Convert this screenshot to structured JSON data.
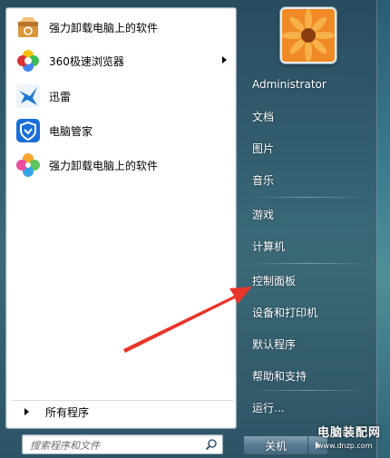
{
  "left_pane": {
    "programs": [
      {
        "label": "强力卸载电脑上的软件",
        "icon": "uninstaller-box-icon",
        "has_submenu": false
      },
      {
        "label": "360极速浏览器",
        "icon": "360-browser-icon",
        "has_submenu": true
      },
      {
        "label": "迅雷",
        "icon": "thunder-bird-icon",
        "has_submenu": false
      },
      {
        "label": "电脑管家",
        "icon": "pc-manager-shield-icon",
        "has_submenu": false
      },
      {
        "label": "强力卸载电脑上的软件",
        "icon": "uninstaller-flower-icon",
        "has_submenu": false
      }
    ],
    "all_programs_label": "所有程序"
  },
  "search": {
    "placeholder": "搜索程序和文件",
    "value": ""
  },
  "right_pane": {
    "user_name": "Administrator",
    "items": [
      {
        "label": "文档"
      },
      {
        "label": "图片"
      },
      {
        "label": "音乐"
      },
      {
        "label": "游戏"
      },
      {
        "label": "计算机"
      },
      {
        "label": "控制面板"
      },
      {
        "label": "设备和打印机"
      },
      {
        "label": "默认程序"
      },
      {
        "label": "帮助和支持"
      },
      {
        "label": "运行..."
      }
    ]
  },
  "shutdown": {
    "label": "关机"
  },
  "watermark": {
    "title": "电脑装配网",
    "url": "www.dnzp.com"
  },
  "colors": {
    "annotation_arrow": "#e8352b",
    "menu_glass": "#3b6a80"
  }
}
